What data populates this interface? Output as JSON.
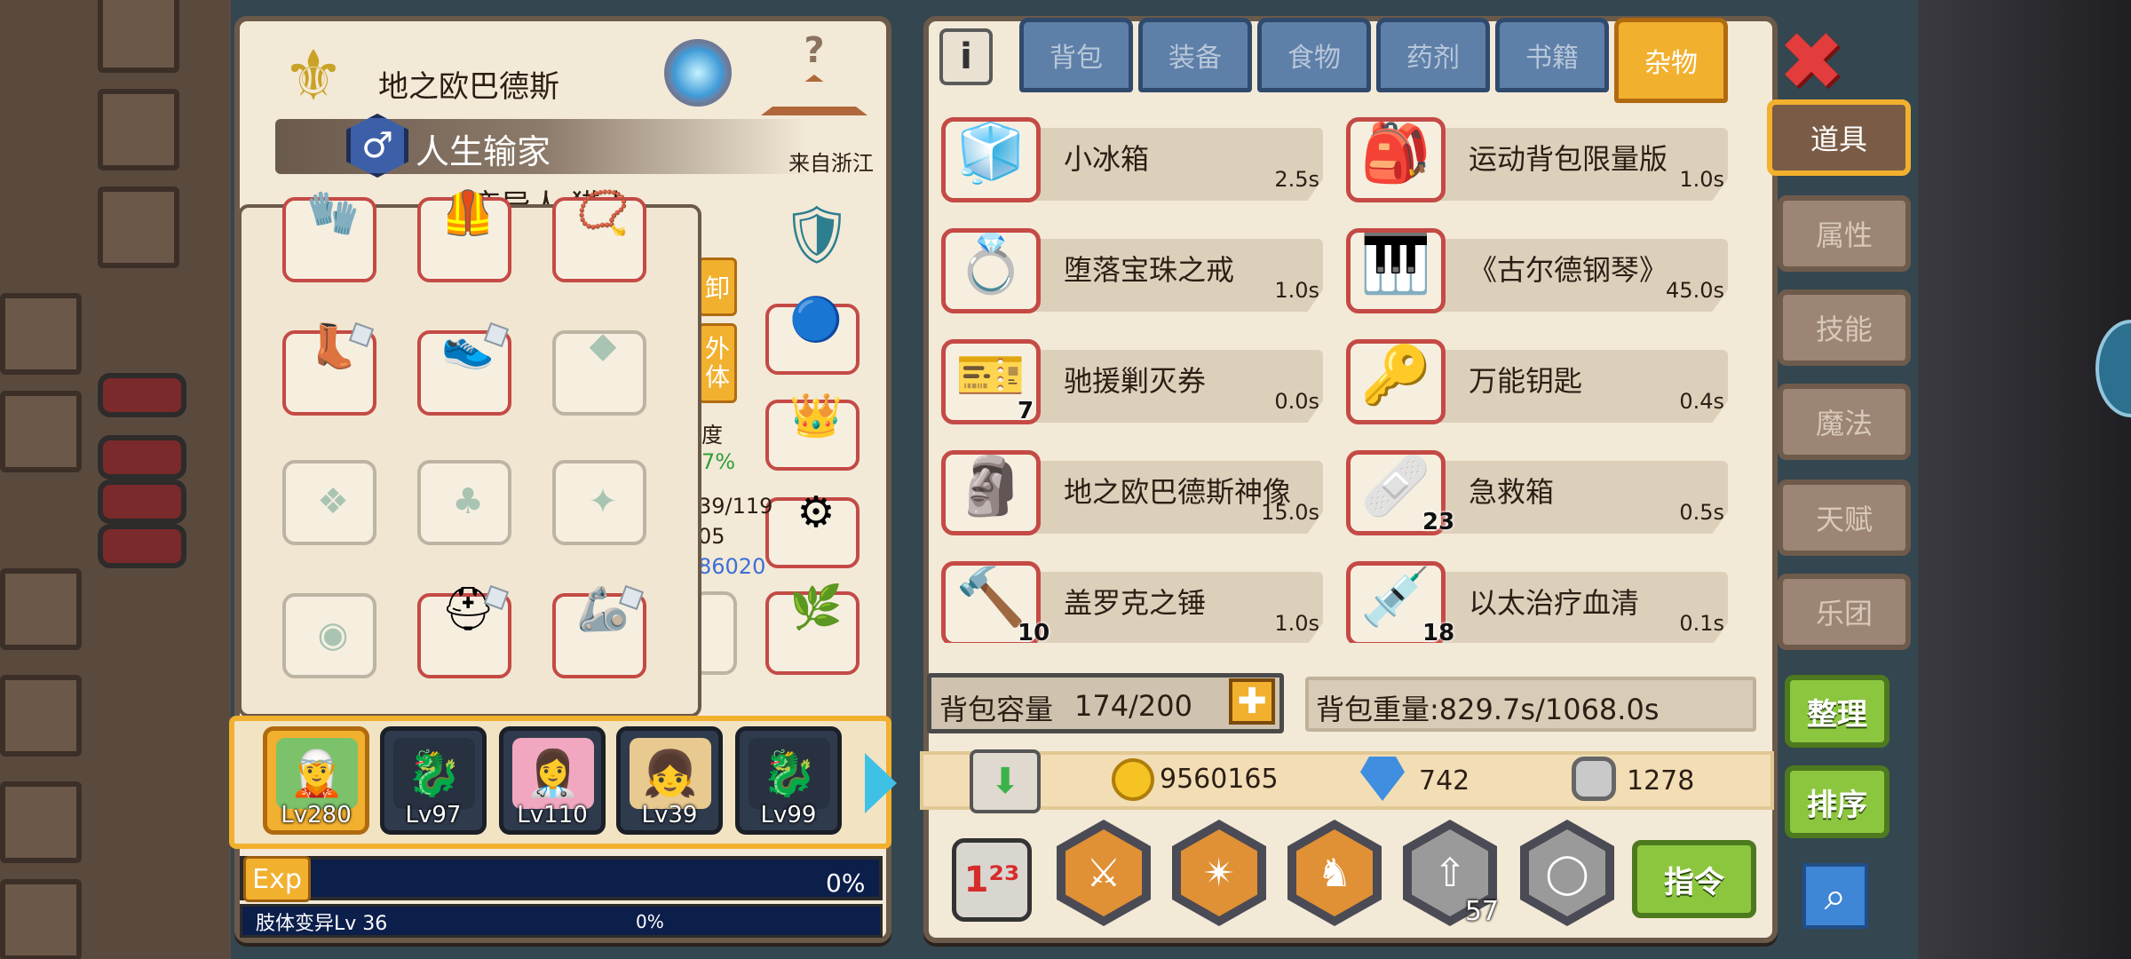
{
  "character": {
    "name": "地之欧巴德斯",
    "title": "人生输家",
    "origin": "来自浙江",
    "class_partial": "变异人 猎人",
    "gender_symbol": "♂",
    "partial_labels": {
      "unload": "卸",
      "appearance": "外\n体",
      "rate": "度",
      "rate_value": "7%",
      "hp": "39/119",
      "stat": "05",
      "blue_value": "86020"
    }
  },
  "top_icons": {
    "help": "?"
  },
  "tabs": [
    {
      "label": "背包"
    },
    {
      "label": "装备"
    },
    {
      "label": "食物"
    },
    {
      "label": "药剂"
    },
    {
      "label": "书籍"
    },
    {
      "label": "杂物",
      "active": true
    }
  ],
  "side_menu": [
    {
      "label": "道具",
      "active": true
    },
    {
      "label": "属性"
    },
    {
      "label": "技能"
    },
    {
      "label": "魔法"
    },
    {
      "label": "天赋"
    },
    {
      "label": "乐团"
    }
  ],
  "items": [
    {
      "name": "小冰箱",
      "weight": "2.5s",
      "count": "",
      "icon": "fridge-icon",
      "glyph": "🧊"
    },
    {
      "name": "运动背包限量版",
      "weight": "1.0s",
      "count": "",
      "icon": "backpack-icon",
      "glyph": "🎒"
    },
    {
      "name": "堕落宝珠之戒",
      "weight": "1.0s",
      "count": "",
      "icon": "ring-icon",
      "glyph": "💍"
    },
    {
      "name": "《古尔德钢琴》",
      "weight": "45.0s",
      "count": "",
      "icon": "piano-icon",
      "glyph": "🎹"
    },
    {
      "name": "驰援剿灭券",
      "weight": "0.0s",
      "count": "7",
      "icon": "ticket-icon",
      "glyph": "🎫"
    },
    {
      "name": "万能钥匙",
      "weight": "0.4s",
      "count": "",
      "icon": "key-icon",
      "glyph": "🔑"
    },
    {
      "name": "地之欧巴德斯神像",
      "weight": "15.0s",
      "count": "",
      "icon": "statue-icon",
      "glyph": "🗿"
    },
    {
      "name": "急救箱",
      "weight": "0.5s",
      "count": "23",
      "icon": "first-aid-icon",
      "glyph": "🩹"
    },
    {
      "name": "盖罗克之锤",
      "weight": "1.0s",
      "count": "10",
      "icon": "hammer-icon",
      "glyph": "🔨"
    },
    {
      "name": "以太治疗血清",
      "weight": "0.1s",
      "count": "18",
      "icon": "syringe-icon",
      "glyph": "💉"
    }
  ],
  "bag": {
    "capacity_label": "背包容量",
    "capacity_value": "174/200",
    "weight_label": "背包重量:829.7s/1068.0s"
  },
  "currency": {
    "gold": "9560165",
    "diamond": "742",
    "silver": "1278"
  },
  "buttons": {
    "sort": "整理",
    "order": "排序",
    "command": "指令",
    "exp": "Exp"
  },
  "skill_badge": "57",
  "exp": {
    "percent": "0%",
    "sub_label": "肢体变异Lv 36",
    "sub_percent": "0%",
    "fill": 0
  },
  "party": [
    {
      "lv": "Lv280",
      "glyph": "🧝",
      "selected": true
    },
    {
      "lv": "Lv97",
      "glyph": "🐉"
    },
    {
      "lv": "Lv110",
      "glyph": "👩‍⚕️"
    },
    {
      "lv": "Lv39",
      "glyph": "👧"
    },
    {
      "lv": "Lv99",
      "glyph": "🐉"
    }
  ]
}
